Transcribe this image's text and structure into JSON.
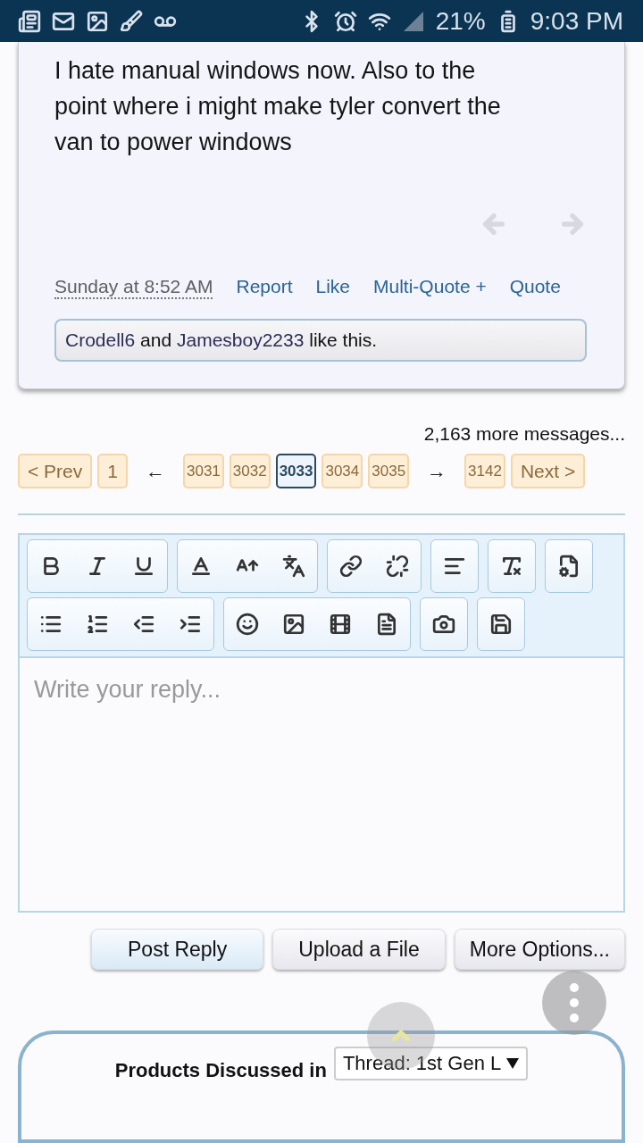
{
  "status_bar": {
    "battery": "21%",
    "time": "9:03 PM"
  },
  "post": {
    "text": "I hate manual windows now. Also to the point where i might make tyler convert the van to power windows",
    "date": "Sunday at 8:52 AM",
    "actions": [
      "Report",
      "Like",
      "Multi-Quote +",
      "Quote"
    ],
    "likes": {
      "users": [
        "Crodell6",
        "Jamesboy2233"
      ],
      "joiner": "and",
      "suffix": "like this."
    }
  },
  "more_messages": "2,163 more messages...",
  "pagination": [
    {
      "kind": "button",
      "label": "< Prev",
      "selected": false
    },
    {
      "kind": "button",
      "label": "1",
      "selected": false
    },
    {
      "kind": "arrow",
      "label": "←"
    },
    {
      "kind": "page",
      "label": "3031",
      "selected": false
    },
    {
      "kind": "page",
      "label": "3032",
      "selected": false
    },
    {
      "kind": "page",
      "label": "3033",
      "selected": true
    },
    {
      "kind": "page",
      "label": "3034",
      "selected": false
    },
    {
      "kind": "page",
      "label": "3035",
      "selected": false
    },
    {
      "kind": "arrow",
      "label": "→"
    },
    {
      "kind": "page",
      "label": "3142",
      "selected": false
    },
    {
      "kind": "button",
      "label": "Next >",
      "selected": false
    }
  ],
  "editor": {
    "placeholder": "Write your reply..."
  },
  "buttons": [
    {
      "label": "Post Reply",
      "primary": true
    },
    {
      "label": "Upload a File",
      "primary": false
    },
    {
      "label": "More Options...",
      "primary": false
    }
  ],
  "products": {
    "label": "Products Discussed in",
    "select": "Thread: 1st Gen L"
  }
}
